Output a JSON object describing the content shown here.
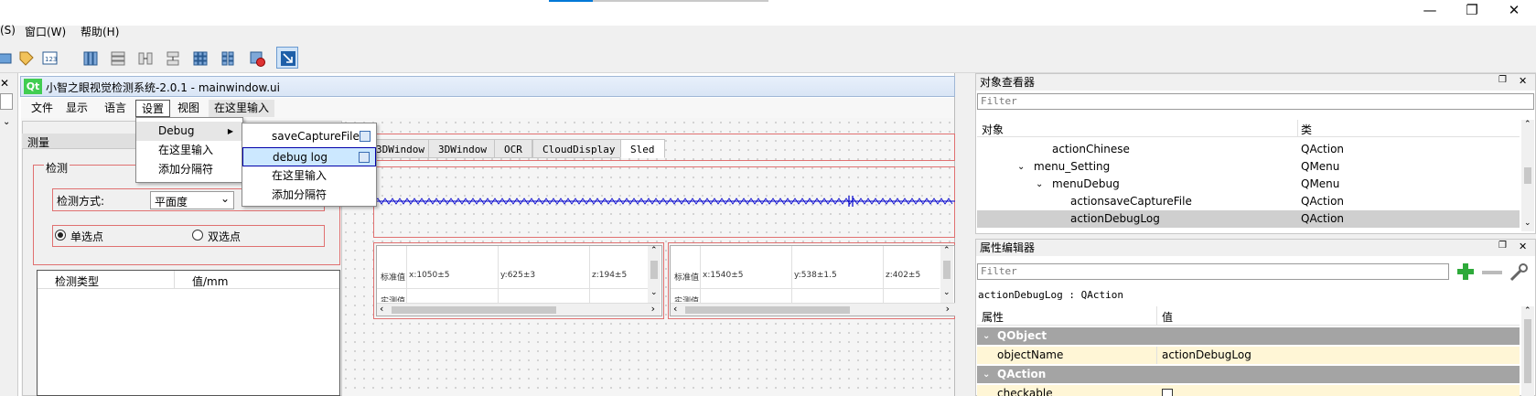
{
  "topmenu": {
    "items": [
      "(S)",
      "窗口(W)",
      "帮助(H)"
    ]
  },
  "window_controls": {
    "minimize": "—",
    "restore": "❐",
    "close": "✕"
  },
  "form": {
    "title": "小智之眼视觉检测系统-2.0.1 - mainwindow.ui",
    "qt_logo": "Qt",
    "menus": [
      "文件",
      "显示",
      "语言",
      "设置",
      "视图",
      "在这里输入"
    ]
  },
  "left_panel": {
    "measure_title": "测量",
    "detect_group": "检测",
    "detect_mode_label": "检测方式:",
    "detect_mode_value": "平面度",
    "radio_single": "单选点",
    "radio_double": "双选点",
    "table_headers": [
      "检测类型",
      "值/mm"
    ]
  },
  "tabs": [
    "3DWindow",
    "3DWindow",
    "OCR",
    "CloudDisplay",
    "Sled"
  ],
  "tables": [
    {
      "cells": [
        "标准值",
        "x:1050±5",
        "y:625±3",
        "z:194±5"
      ],
      "row2": "实测值"
    },
    {
      "cells": [
        "标准值",
        "x:1540±5",
        "y:538±1.5",
        "z:402±5"
      ],
      "row2": "实测值"
    }
  ],
  "setting_menu": {
    "items": [
      "Debug",
      "在这里输入",
      "添加分隔符"
    ],
    "arrow": "▶"
  },
  "debug_submenu": {
    "items": [
      "saveCaptureFile",
      "debug log",
      "在这里输入",
      "添加分隔符"
    ]
  },
  "object_inspector": {
    "title": "对象查看器",
    "filter_placeholder": "Filter",
    "col_object": "对象",
    "col_class": "类",
    "rows": [
      {
        "name": "actionChinese",
        "cls": "QAction"
      },
      {
        "name": "menu_Setting",
        "cls": "QMenu"
      },
      {
        "name": "menuDebug",
        "cls": "QMenu"
      },
      {
        "name": "actionsaveCaptureFile",
        "cls": "QAction"
      },
      {
        "name": "actionDebugLog",
        "cls": "QAction"
      }
    ]
  },
  "property_editor": {
    "title": "属性编辑器",
    "filter_placeholder": "Filter",
    "object_label": "actionDebugLog : QAction",
    "col_prop": "属性",
    "col_value": "值",
    "group1": "QObject",
    "prop1_name": "objectName",
    "prop1_value": "actionDebugLog",
    "group2": "QAction",
    "prop2_name": "checkable"
  },
  "colors": {
    "accent_select": "#cce8ff",
    "menu_highlight": "#0000aa",
    "wave": "#0000cc"
  }
}
